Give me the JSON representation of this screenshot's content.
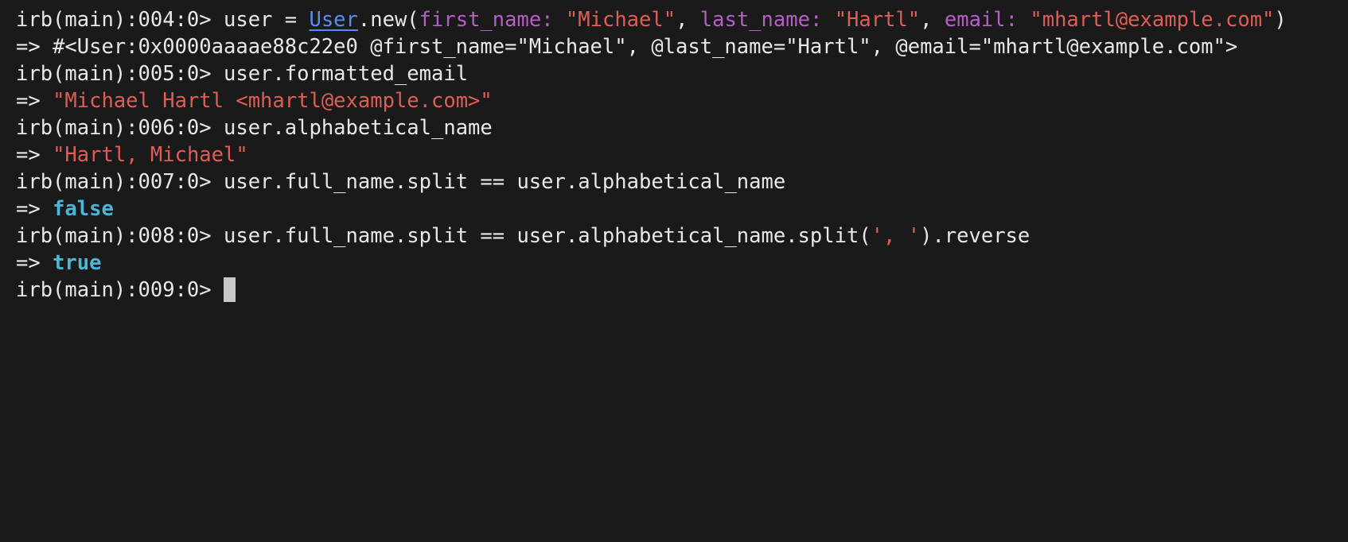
{
  "window": {
    "clipped_top_text": "=>"
  },
  "lines": [
    {
      "prompt": "irb(main):004:0> ",
      "segments": {
        "a": "user = ",
        "const": "User",
        "b": ".new(",
        "k1": "first_name:",
        "s1": " ",
        "v1": "\"Michael\"",
        "c1": ", ",
        "k2": "last_name:",
        "s2": " ",
        "v2": "\"Hartl\"",
        "c2": ", ",
        "k3": "email:",
        "s3": " ",
        "v3": "\"mhartl@example.com\"",
        "end": ")"
      }
    },
    {
      "text": "=> #<User:0x0000aaaae88c22e0 @first_name=\"Michael\", @last_name=\"Hartl\", @email=\"mhartl@example.com\">"
    },
    {
      "prompt": "irb(main):005:0> ",
      "text": "user.formatted_email"
    },
    {
      "arrow": "=> ",
      "text": "\"Michael Hartl <mhartl@example.com>\""
    },
    {
      "prompt": "irb(main):006:0> ",
      "text": "user.alphabetical_name"
    },
    {
      "arrow": "=> ",
      "text": "\"Hartl, Michael\""
    },
    {
      "prompt": "irb(main):007:0> ",
      "text": "user.full_name.split == user.alphabetical_name"
    },
    {
      "arrow": "=> ",
      "text": "false"
    },
    {
      "prompt": "irb(main):008:0> ",
      "segments": {
        "a": "user.full_name.split == user.alphabetical_name.split(",
        "str": "', '",
        "b": ").reverse"
      }
    },
    {
      "arrow": "=> ",
      "text": "true"
    },
    {
      "prompt": "irb(main):009:0> "
    }
  ],
  "colors": {
    "background": "#1a1a1a",
    "foreground": "#e8e8e8",
    "constant": "#5a8cf0",
    "symbol_key": "#b55ec6",
    "string": "#e05d55",
    "boolean": "#4ab6d8",
    "cursor": "#c8c8c8"
  }
}
